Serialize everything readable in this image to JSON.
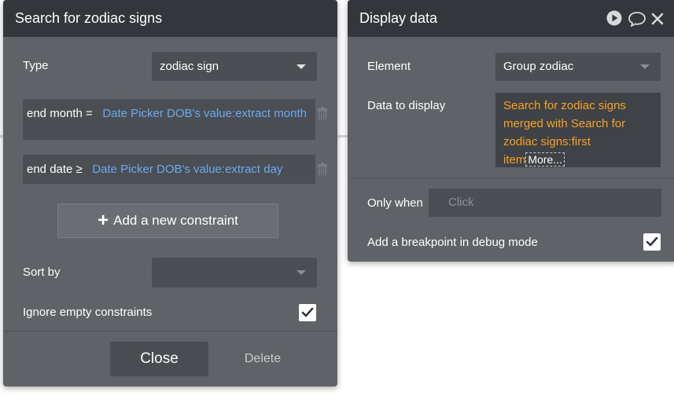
{
  "search_panel": {
    "title": "Search for zodiac signs",
    "type_label": "Type",
    "type_value": "zodiac sign",
    "constraints": [
      {
        "field": "end month =",
        "expr": "Date Picker DOB's value:extract month"
      },
      {
        "field": "end date ≥",
        "expr": "Date Picker DOB's value:extract day"
      }
    ],
    "add_constraint_label": "Add a new constraint",
    "sort_by_label": "Sort by",
    "sort_by_value": "",
    "ignore_empty_label": "Ignore empty constraints",
    "ignore_empty_checked": true,
    "close_label": "Close",
    "delete_label": "Delete"
  },
  "display_panel": {
    "title": "Display data",
    "element_label": "Element",
    "element_value": "Group zodiac",
    "data_label": "Data to display",
    "data_value": "Search for zodiac signs merged with Search for zodiac signs:first item",
    "more_label": "More...",
    "only_when_label": "Only when",
    "only_when_placeholder": "Click",
    "breakpoint_label": "Add a breakpoint in debug mode",
    "breakpoint_checked": true
  },
  "icons": {
    "play": "play-icon",
    "comment": "comment-icon",
    "close": "close-icon",
    "trash": "trash-icon",
    "check": "check-icon",
    "plus": "plus-icon"
  },
  "colors": {
    "panel_bg": "#5f6266",
    "header_bg": "#33373b",
    "field_bg": "#4b4e52",
    "expression_blue": "#6aaaf4",
    "dynamic_orange": "#f7a224"
  }
}
